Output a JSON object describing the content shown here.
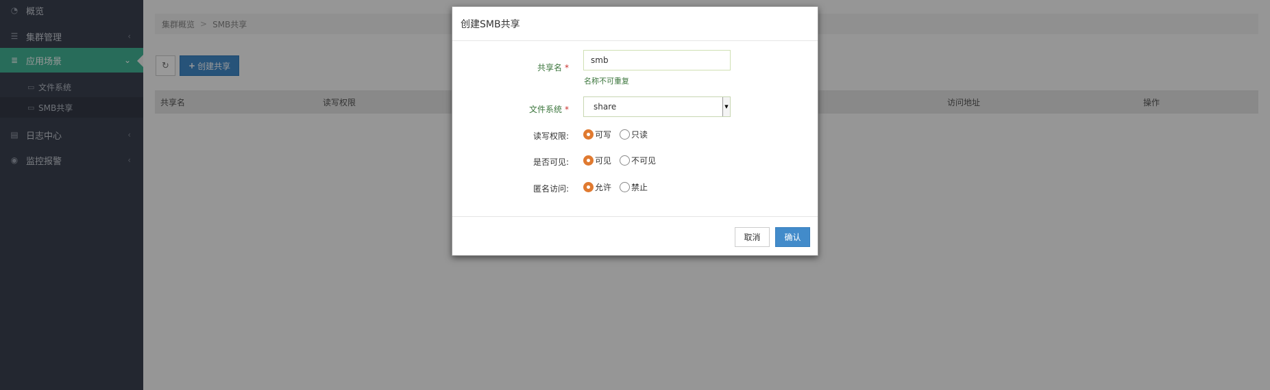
{
  "sidebar": {
    "items": [
      {
        "label": "概览",
        "icon": "dashboard-icon"
      },
      {
        "label": "集群管理",
        "icon": "list-icon"
      },
      {
        "label": "应用场景",
        "icon": "database-icon"
      },
      {
        "label": "日志中心",
        "icon": "file-icon"
      },
      {
        "label": "监控报警",
        "icon": "eye-icon"
      }
    ],
    "sub_items": [
      {
        "label": "文件系统",
        "icon": "folder-icon"
      },
      {
        "label": "SMB共享",
        "icon": "folder-open-icon"
      }
    ]
  },
  "breadcrumb": {
    "root": "集群概览",
    "separator": ">",
    "current": "SMB共享"
  },
  "toolbar": {
    "refresh_icon": "refresh-icon",
    "create_label": "创建共享"
  },
  "table": {
    "headers": [
      "共享名",
      "读写权限",
      "访问地址",
      "操作"
    ]
  },
  "modal": {
    "title": "创建SMB共享",
    "share_name": {
      "label": "共享名",
      "value": "smb",
      "hint": "名称不可重复"
    },
    "filesystem": {
      "label": "文件系统",
      "value": "share"
    },
    "rw_permission": {
      "label": "读写权限:",
      "options": [
        "可写",
        "只读"
      ],
      "selected": "可写"
    },
    "visible": {
      "label": "是否可见:",
      "options": [
        "可见",
        "不可见"
      ],
      "selected": "可见"
    },
    "anonymous": {
      "label": "匿名访问:",
      "options": [
        "允许",
        "禁止"
      ],
      "selected": "允许"
    },
    "required_mark": "*",
    "cancel_label": "取消",
    "confirm_label": "确认"
  },
  "colors": {
    "sidebar_bg": "#3b4150",
    "active_bg": "#44b597",
    "primary": "#428bca",
    "radio_checked": "#e07a30",
    "label_required": "#3c763d"
  }
}
